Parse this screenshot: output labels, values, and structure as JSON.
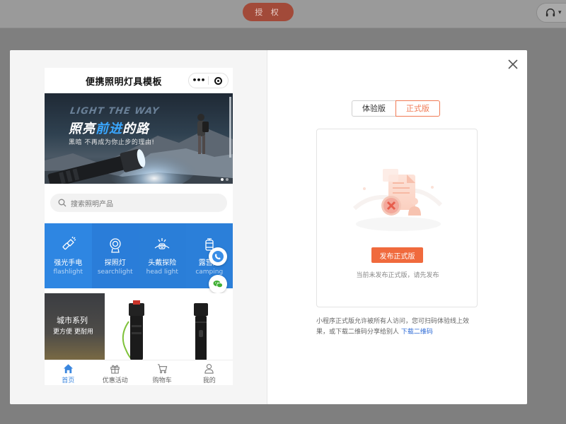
{
  "background": {
    "auth_button": "授 权",
    "support_icon": "headset-icon"
  },
  "modal": {
    "close_icon": "close-icon"
  },
  "phone": {
    "nav_title": "便携照明灯具模板",
    "capsule_more": "•••",
    "banner": {
      "english_slogan": "LIGHT THE WAY",
      "slogan_prefix": "照亮",
      "slogan_highlight": "前进",
      "slogan_suffix": "的路",
      "subline": "黑暗 不再成为你止步的理由!"
    },
    "search_placeholder": "搜索照明产品",
    "categories": [
      {
        "label": "强光手电",
        "sub": "flashlight",
        "icon": "flashlight-icon"
      },
      {
        "label": "探照灯",
        "sub": "searchlight",
        "icon": "searchlight-icon"
      },
      {
        "label": "头戴探险",
        "sub": "head light",
        "icon": "headlamp-icon"
      },
      {
        "label": "露营灯",
        "sub": "camping",
        "icon": "camping-lamp-icon"
      }
    ],
    "float_buttons": [
      "phone-icon",
      "wechat-icon"
    ],
    "products": {
      "city_title": "城市系列",
      "city_sub": "更方便 更耐用"
    },
    "tabs": [
      {
        "label": "首页",
        "icon": "home-icon",
        "active": true
      },
      {
        "label": "优惠活动",
        "icon": "gift-icon",
        "active": false
      },
      {
        "label": "购物车",
        "icon": "cart-icon",
        "active": false
      },
      {
        "label": "我的",
        "icon": "user-icon",
        "active": false
      }
    ]
  },
  "panel": {
    "version_tabs": [
      "体验版",
      "正式版"
    ],
    "selected_version": "正式版",
    "publish_button": "发布正式版",
    "empty_hint": "当前未发布正式版，请先发布",
    "description": "小程序正式版允许被所有人访问，您可扫码体验线上效果，或下载二维码分享给别人",
    "download_link": "下载二维码"
  },
  "colors": {
    "accent": "#f06a3d",
    "category_blue": "#2e86e2",
    "tab_active": "#3a86de",
    "link": "#2e6bd6"
  }
}
